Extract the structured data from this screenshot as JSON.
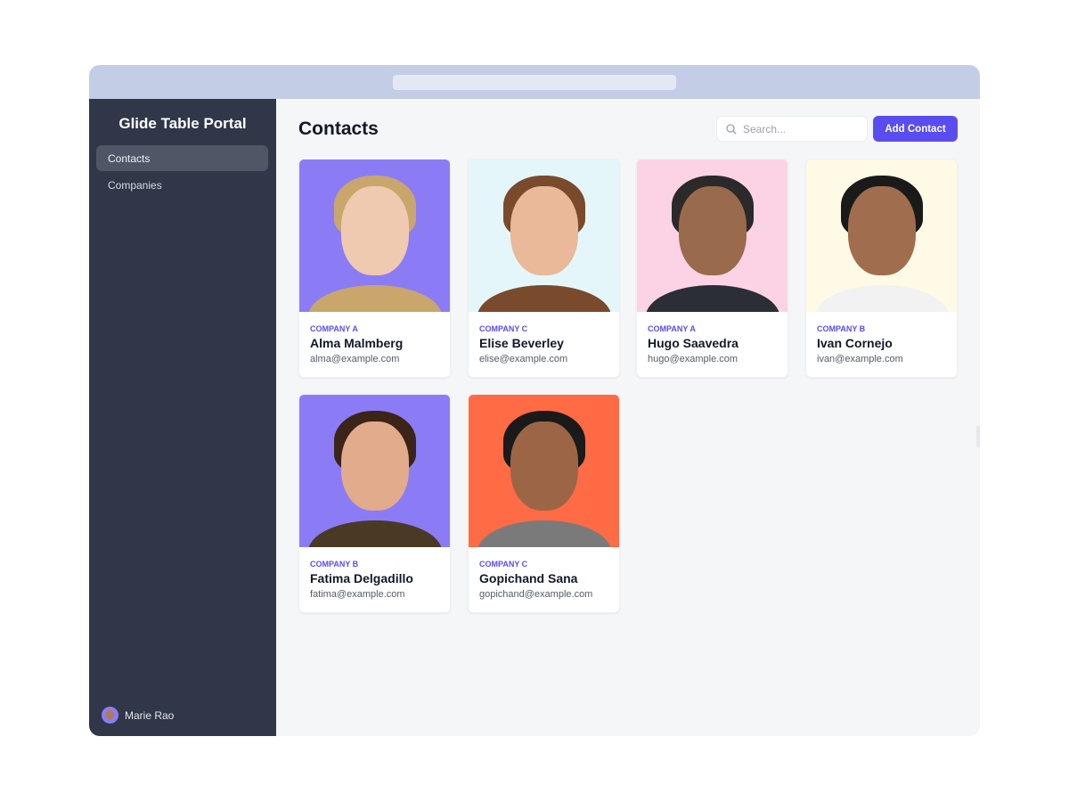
{
  "app": {
    "title": "Glide Table Portal"
  },
  "sidebar": {
    "items": [
      {
        "label": "Contacts",
        "active": true
      },
      {
        "label": "Companies",
        "active": false
      }
    ],
    "user": {
      "name": "Marie Rao"
    }
  },
  "main": {
    "title": "Contacts",
    "search_placeholder": "Search...",
    "add_label": "Add Contact"
  },
  "contacts": [
    {
      "company": "Company A",
      "name": "Alma Malmberg",
      "email": "alma@example.com",
      "bg": "#8b7cf6",
      "hair": "#c9a66b",
      "skin": "#efc9b0",
      "shirt": "#c9a66b"
    },
    {
      "company": "Company C",
      "name": "Elise Beverley",
      "email": "elise@example.com",
      "bg": "#e4f6fa",
      "hair": "#7a4a2c",
      "skin": "#e9b99a",
      "shirt": "#7a4a2c"
    },
    {
      "company": "Company A",
      "name": "Hugo Saavedra",
      "email": "hugo@example.com",
      "bg": "#fcd3e4",
      "hair": "#2a2a2a",
      "skin": "#9a6a4c",
      "shirt": "#2b2e36"
    },
    {
      "company": "Company B",
      "name": "Ivan Cornejo",
      "email": "ivan@example.com",
      "bg": "#fefae6",
      "hair": "#1a1a1a",
      "skin": "#a06e4e",
      "shirt": "#f2f2f2"
    },
    {
      "company": "Company B",
      "name": "Fatima Delgadillo",
      "email": "fatima@example.com",
      "bg": "#8b7cf6",
      "hair": "#3b2418",
      "skin": "#e1ab8c",
      "shirt": "#4a3a25"
    },
    {
      "company": "Company C",
      "name": "Gopichand Sana",
      "email": "gopichand@example.com",
      "bg": "#ff6b45",
      "hair": "#1a1a1a",
      "skin": "#9c6646",
      "shirt": "#7a7a7a"
    }
  ]
}
